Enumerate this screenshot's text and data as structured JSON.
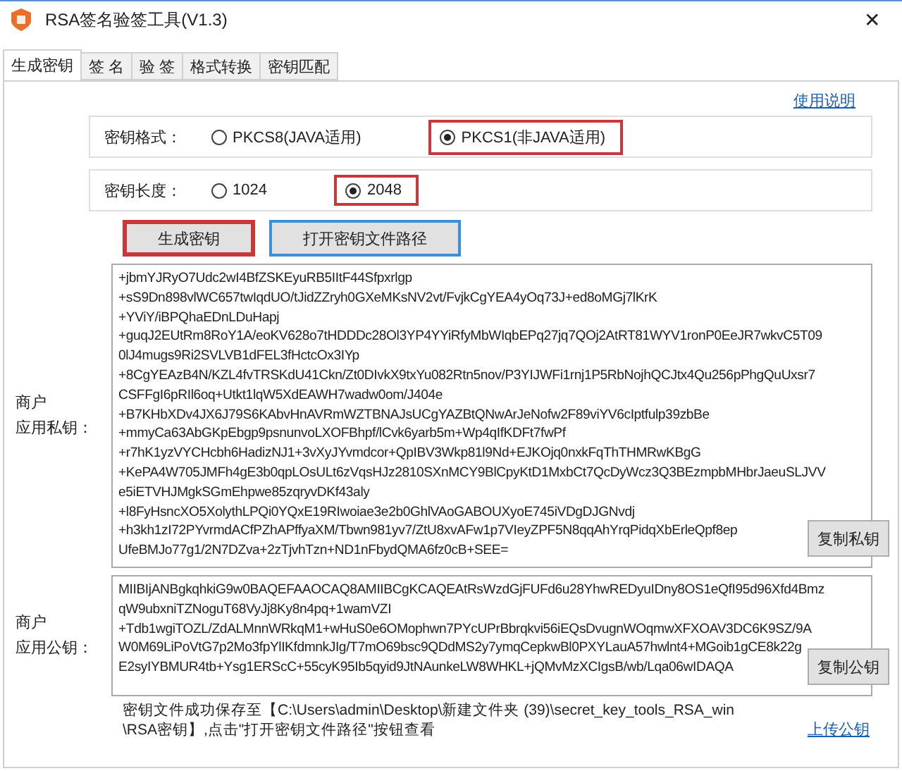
{
  "window": {
    "title": "RSA签名验签工具(V1.3)",
    "close": "✕"
  },
  "tabs": [
    {
      "label": "生成密钥",
      "selected": true
    },
    {
      "label": "签 名",
      "selected": false
    },
    {
      "label": "验 签",
      "selected": false
    },
    {
      "label": "格式转换",
      "selected": false
    },
    {
      "label": "密钥匹配",
      "selected": false
    }
  ],
  "help_link": "使用说明",
  "groups": [
    {
      "label": "密钥格式：",
      "options": [
        {
          "label": "PKCS8(JAVA适用)",
          "selected": false
        },
        {
          "label": "PKCS1(非JAVA适用)",
          "selected": true
        }
      ]
    },
    {
      "label": "密钥长度：",
      "options": [
        {
          "label": "1024",
          "selected": false
        },
        {
          "label": "2048",
          "selected": true
        }
      ]
    }
  ],
  "buttons": [
    {
      "label": "生成密钥",
      "highlighted": true,
      "focused": false
    },
    {
      "label": "打开密钥文件路径",
      "highlighted": false,
      "focused": true
    }
  ],
  "private_key": {
    "label_lines": [
      "商户",
      "应用私钥："
    ],
    "copy_button": "复制私钥",
    "lines": [
      "+jbmYJRyO7Udc2wI4BfZSKEyuRB5IItF44Sfpxrlgp",
      "+sS9Dn898vlWC657twIqdUO/tJidZZryh0GXeMKsNV2vt/FvjkCgYEA4yOq73J+ed8oMGj7lKrK",
      "+YViY/iBPQhaEDnLDuHapj",
      "+guqJ2EUtRm8RoY1A/eoKV628o7tHDDDc28Ol3YP4YYiRfyMbWIqbEPq27jq7QOj2AtRT81WYV1ronP0EeJR7wkvC5T09",
      "0lJ4mugs9Ri2SVLVB1dFEL3fHctcOx3IYp",
      "+8CgYEAzB4N/KZL4fvTRSKdU41Ckn/Zt0DIvkX9txYu082Rtn5nov/P3YIJWFi1rnj1P5RbNojhQCJtx4Qu256pPhgQuUxsr7",
      "CSFFgI6pRIl6oq+Utkt1lqW5XdEAWH7wadw0om/J404e",
      "+B7KHbXDv4JX6J79S6KAbvHnAVRmWZTBNAJsUCgYAZBtQNwArJeNofw2F89viYV6cIptfulp39zbBe",
      "+mmyCa63AbGKpEbgp9psnunvoLXOFBhpf/lCvk6yarb5m+Wp4qIfKDFt7fwPf",
      "+r7hK1yzVYCHcbh6HadizNJ1+3vXyJYvmdcor+QpIBV3Wkp81l9Nd+EJKOjq0nxkFqThTHMRwKBgG",
      "+KePA4W705JMFh4gE3b0qpLOsULt6zVqsHJz2810SXnMCY9BlCpyKtD1MxbCt7QcDyWcz3Q3BEzmpbMHbrJaeuSLJVV",
      "e5iETVHJMgkSGmEhpwe85zqryvDKf43aly",
      "+l8FyHsncXO5XolythLPQi0YQxE19RIwoiae3e2b0GhlVAoGABOUXyoE745iVDgDJGNvdj",
      "+h3kh1zI72PYvrmdACfPZhAPffyaXM/Tbwn981yv7/ZtU8xvAFw1p7VIeyZPF5N8qqAhYrqPidqXbErleQpf8ep",
      "UfeBMJo77g1/2N7DZva+2zTjvhTzn+ND1nFbydQMA6fz0cB+SEE="
    ]
  },
  "public_key": {
    "label_lines": [
      "商户",
      "应用公钥："
    ],
    "copy_button": "复制公钥",
    "lines": [
      "MIIBIjANBgkqhkiG9w0BAQEFAAOCAQ8AMIIBCgKCAQEAtRsWzdGjFUFd6u28YhwREDyuIDny8OS1eQfI95d96Xfd4Bmz",
      "qW9ubxniTZNoguT68VyJj8Ky8n4pq+1wamVZI",
      "+Tdb1wgiTOZL/ZdALMnnWRkqM1+wHuS0e6OMophwn7PYcUPrBbrqkvi56iEQsDvugnWOqmwXFXOAV3DC6K9SZ/9A",
      "W0M69LiPoVtG7p2Mo3fpYlIKfdmnkJIg/T7mO69bsc9QDdMS2y7ymqCepkwBl0PXYLauA57hwlnt4+MGoib1gCE8k22g",
      "E2syIYBMUR4tb+Ysg1ERScC+55cyK95Ib5qyid9JtNAunkeLW8WHKL+jQMvMzXCIgsB/wb/Lqa06wIDAQA"
    ]
  },
  "status_text": "密钥文件成功保存至【C:\\Users\\admin\\Desktop\\新建文件夹 (39)\\secret_key_tools_RSA_win\\RSA密钥】,点击\"打开密钥文件路径\"按钮查看",
  "upload_link": "上传公钥"
}
